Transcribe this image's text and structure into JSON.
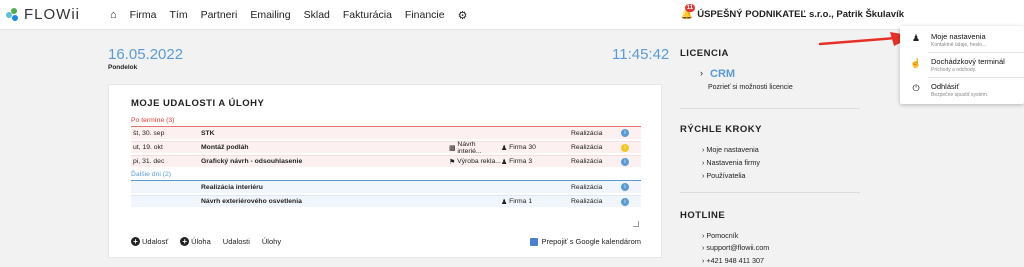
{
  "brand": {
    "name": "FLOWii"
  },
  "nav": {
    "items": [
      "Firma",
      "Tím",
      "Partneri",
      "Emailing",
      "Sklad",
      "Fakturácia",
      "Financie"
    ]
  },
  "user": {
    "badge": "11",
    "label": "ÚSPEŠNÝ PODNIKATEĽ s.r.o., Patrik Škulavík"
  },
  "header": {
    "date": "16.05.2022",
    "day": "Pondelok",
    "time": "11:45:42"
  },
  "events": {
    "title": "MOJE UDALOSTI A ÚLOHY",
    "overdue_label": "Po termíne (3)",
    "next_label": "Ďalšie dni (2)",
    "overdue": [
      {
        "date": "št, 30. sep",
        "title": "STK",
        "work": "",
        "firm": "",
        "status": "Realizácia",
        "dot": "#5b9bd5"
      },
      {
        "date": "ut, 19. okt",
        "title": "Montáž podláh",
        "work": "Návrh interié...",
        "firm": "Firma 30",
        "status": "Realizácia",
        "dot": "#f3c623"
      },
      {
        "date": "pi, 31. dec",
        "title": "Grafický návrh - odsouhlasenie",
        "work": "Výroba rekla...",
        "firm": "Firma 3",
        "status": "Realizácia",
        "dot": "#5b9bd5"
      }
    ],
    "next": [
      {
        "date": "",
        "title": "Realizácia interiéru",
        "work": "",
        "firm": "",
        "status": "Realizácia",
        "dot": "#5b9bd5"
      },
      {
        "date": "",
        "title": "Návrh exteriérového osvetlenia",
        "work": "",
        "firm": "Firma 1",
        "status": "Realizácia",
        "dot": "#5b9bd5"
      }
    ],
    "add_event": "Udalosť",
    "add_task": "Úloha",
    "events_link": "Udalosti",
    "tasks_link": "Úlohy",
    "gcal": "Prepojiť s Google kalendárom"
  },
  "sidebar": {
    "license_title": "LICENCIA",
    "license_name": "CRM",
    "license_text": "Pozrieť si možnosti licencie",
    "quick_title": "RÝCHLE KROKY",
    "quick_items": [
      "Moje nastavenia",
      "Nastavenia firmy",
      "Používatelia"
    ],
    "hotline_title": "HOTLINE",
    "hotline_items": [
      "Pomocník",
      "support@flowii.com",
      "+421 948 411 307"
    ]
  },
  "dropdown": {
    "items": [
      {
        "title": "Moje nastavenia",
        "sub": "Kontaktné údaje, heslo...",
        "icon": "person-icon"
      },
      {
        "title": "Dochádzkový terminál",
        "sub": "Príchody a odchody.",
        "icon": "touch-icon"
      },
      {
        "title": "Odhlásiť",
        "sub": "Bezpečne spustiť systém.",
        "icon": "power-icon"
      }
    ]
  },
  "colors": {
    "accent": "#5b9bd5",
    "overdue": "#e53935",
    "arrow": "#e8302a"
  }
}
